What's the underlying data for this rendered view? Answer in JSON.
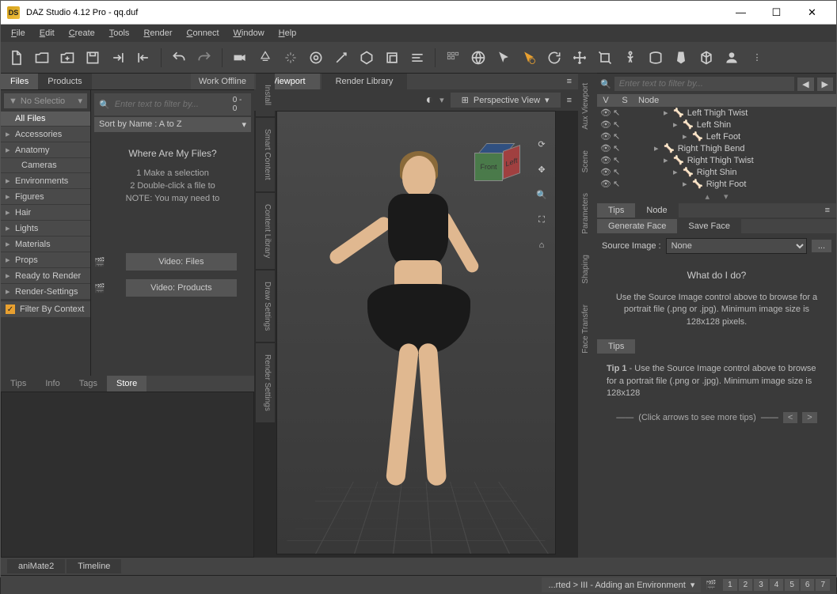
{
  "window": {
    "title": "DAZ Studio 4.12 Pro - qq.duf",
    "icon_label": "DS"
  },
  "menu": [
    "File",
    "Edit",
    "Create",
    "Tools",
    "Render",
    "Connect",
    "Window",
    "Help"
  ],
  "left": {
    "tabs": [
      "Files",
      "Products"
    ],
    "active": 0,
    "work_offline": "Work Offline",
    "selector": "No Selectio",
    "categories": [
      {
        "label": "All Files",
        "expand": false,
        "sel": true
      },
      {
        "label": "Accessories",
        "expand": true
      },
      {
        "label": "Anatomy",
        "expand": true
      },
      {
        "label": "Cameras",
        "expand": false,
        "indent": true
      },
      {
        "label": "Environments",
        "expand": true
      },
      {
        "label": "Figures",
        "expand": true
      },
      {
        "label": "Hair",
        "expand": true
      },
      {
        "label": "Lights",
        "expand": true
      },
      {
        "label": "Materials",
        "expand": true
      },
      {
        "label": "Props",
        "expand": true
      },
      {
        "label": "Ready to Render",
        "expand": true
      },
      {
        "label": "Render-Settings",
        "expand": true
      }
    ],
    "filter_ctx": "Filter By Context",
    "search_placeholder": "Enter text to filter by...",
    "search_count": "0 - 0",
    "sort": "Sort by Name : A to Z",
    "where_title": "Where Are My Files?",
    "where_step1": "1  Make a selection",
    "where_step2": "2  Double-click a file to",
    "where_note": "NOTE: You may need to",
    "video_files": "Video: Files",
    "video_products": "Video:  Products",
    "bottom_tabs": [
      "Tips",
      "Info",
      "Tags",
      "Store"
    ],
    "bottom_active": 3
  },
  "center": {
    "tabs": [
      "Viewport",
      "Render Library"
    ],
    "active": 0,
    "view_mode": "Perspective View",
    "vtabs_left": [
      "Install",
      "Smart Content",
      "Content Library",
      "Draw Settings",
      "Render Settings"
    ],
    "cube": {
      "front": "Front",
      "right": "Left"
    }
  },
  "right": {
    "vtabs": [
      "Aux Viewport",
      "Scene",
      "Parameters",
      "Shaping",
      "Face Transfer"
    ],
    "search_placeholder": "Enter text to filter by...",
    "scene_cols": [
      "V",
      "S",
      "Node"
    ],
    "tree": [
      {
        "label": "Left Thigh Twist",
        "indent": 4
      },
      {
        "label": "Left Shin",
        "indent": 5
      },
      {
        "label": "Left Foot",
        "indent": 6
      },
      {
        "label": "Right Thigh Bend",
        "indent": 3
      },
      {
        "label": "Right Thigh Twist",
        "indent": 4
      },
      {
        "label": "Right Shin",
        "indent": 5
      },
      {
        "label": "Right Foot",
        "indent": 6
      }
    ],
    "panel_tabs": [
      "Tips",
      "Node"
    ],
    "gen_tabs": [
      "Generate Face",
      "Save Face"
    ],
    "src_label": "Source Image :",
    "src_value": "None",
    "help_title": "What do I do?",
    "help_text": "Use the Source Image control above to browse for a portrait file (.png or .jpg). Minimum image size is 128x128 pixels.",
    "tips_tab": "Tips",
    "tip_label": "Tip 1",
    "tip_text": " - Use the Source Image control above to browse for a portrait file (.png or .jpg). Minimum image size is 128x128",
    "tips_nav": "(Click arrows to see more tips)"
  },
  "bottom": {
    "tabs": [
      "aniMate2",
      "Timeline"
    ]
  },
  "status": {
    "dropdown": "...rted > III - Adding an Environment",
    "pages": [
      "1",
      "2",
      "3",
      "4",
      "5",
      "6",
      "7"
    ]
  }
}
